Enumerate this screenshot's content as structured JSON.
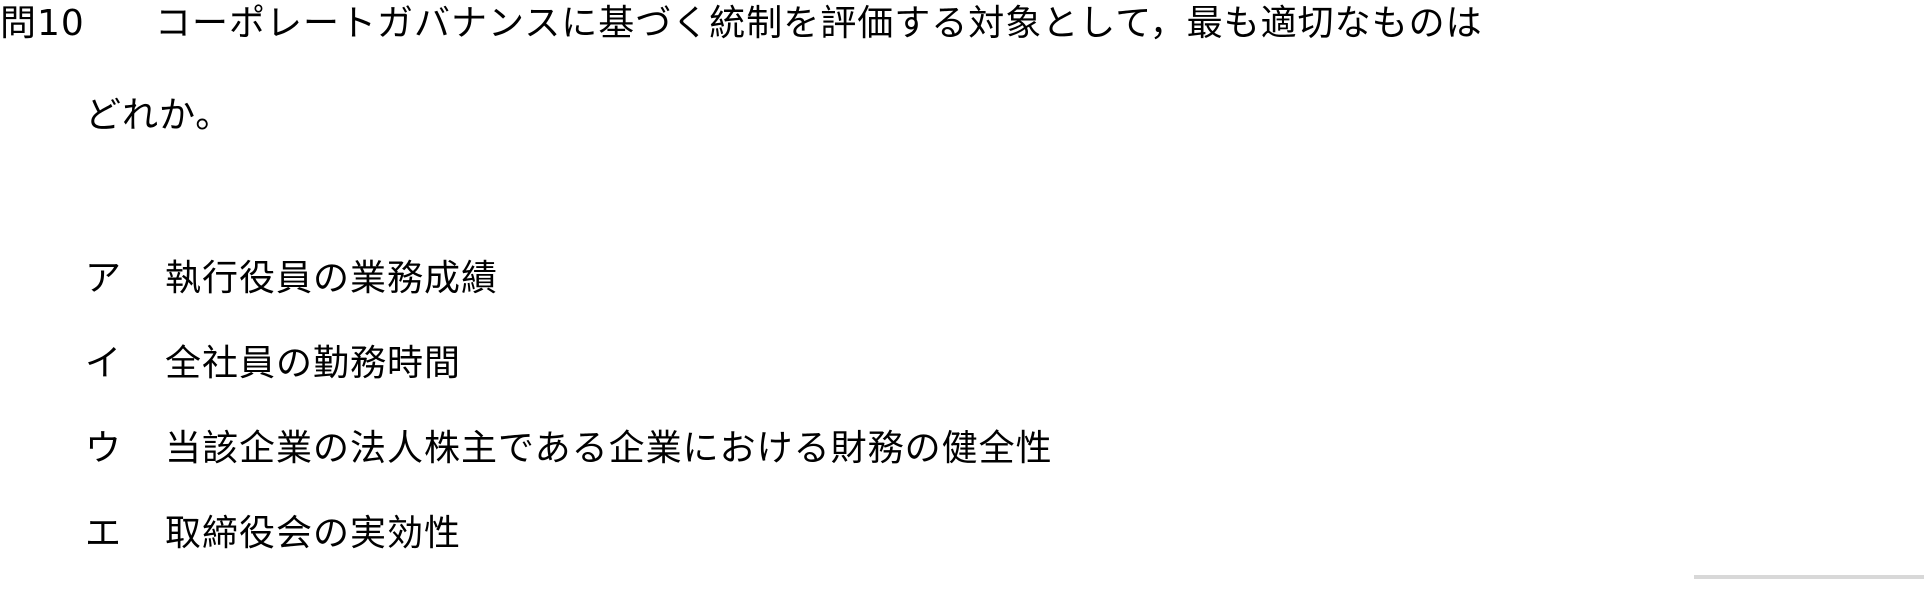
{
  "question": {
    "number": "問10",
    "text_line1": "コーポレートガバナンスに基づく統制を評価する対象として，最も適切なものは",
    "text_line2": "どれか。"
  },
  "choices": [
    {
      "label": "ア",
      "text": "執行役員の業務成績"
    },
    {
      "label": "イ",
      "text": "全社員の勤務時間"
    },
    {
      "label": "ウ",
      "text": "当該企業の法人株主である企業における財務の健全性"
    },
    {
      "label": "エ",
      "text": "取締役会の実効性"
    }
  ]
}
